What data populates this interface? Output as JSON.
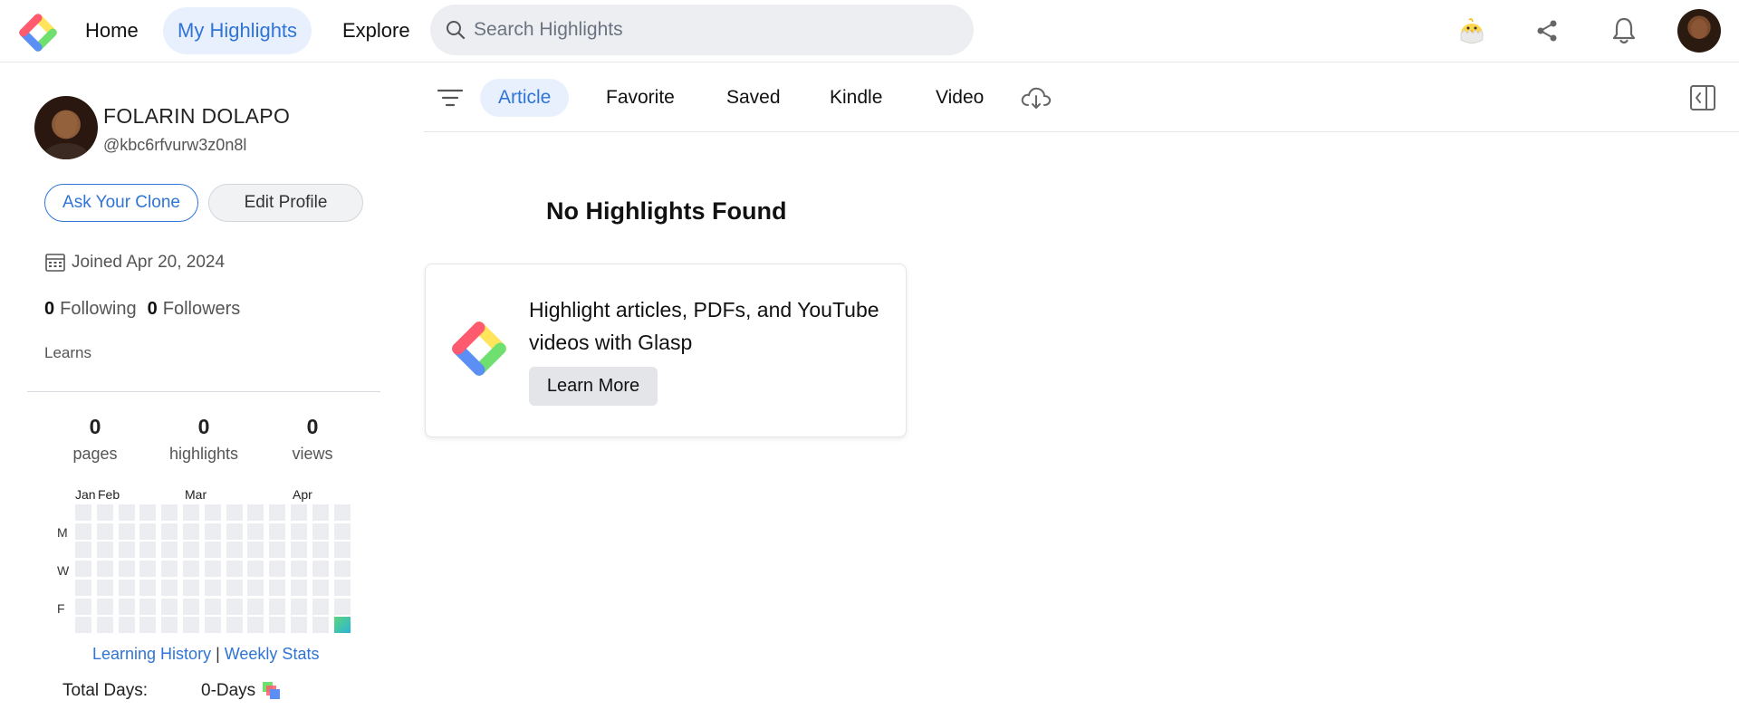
{
  "topbar": {
    "nav": {
      "home": "Home",
      "my_highlights": "My Highlights",
      "explore": "Explore"
    },
    "search": {
      "placeholder": "Search Highlights",
      "value": ""
    },
    "icons": [
      "chick-icon",
      "share-icon",
      "bell-icon",
      "avatar"
    ]
  },
  "profile": {
    "name": "FOLARIN DOLAPO",
    "handle": "@kbc6rfvurw3z0n8l",
    "ask_clone_label": "Ask Your Clone",
    "edit_profile_label": "Edit Profile",
    "joined": "Joined Apr 20, 2024",
    "following_count": "0",
    "following_label": "Following",
    "followers_count": "0",
    "followers_label": "Followers",
    "learns_label": "Learns"
  },
  "stats": {
    "pages": {
      "value": "0",
      "label": "pages"
    },
    "highlights": {
      "value": "0",
      "label": "highlights"
    },
    "views": {
      "value": "0",
      "label": "views"
    }
  },
  "heatmap": {
    "months": [
      "Jan",
      "Feb",
      "Mar",
      "Apr"
    ],
    "days": [
      "M",
      "W",
      "F"
    ],
    "weeks": 13,
    "rows": 7,
    "active_cells": [
      [
        12,
        6
      ]
    ],
    "colors": {
      "empty": "#ebedf0",
      "active_start": "#5bd67a",
      "active_end": "#2bb3d9"
    }
  },
  "history": {
    "learning_history": "Learning History",
    "separator": "|",
    "weekly_stats": "Weekly Stats",
    "total_days_label": "Total Days:",
    "total_days_value": "0-Days"
  },
  "tabs": {
    "article": "Article",
    "favorite": "Favorite",
    "saved": "Saved",
    "kindle": "Kindle",
    "video": "Video",
    "active": "Article"
  },
  "empty_state": {
    "title": "No Highlights Found",
    "promo_text": "Highlight articles, PDFs, and YouTube videos with Glasp",
    "learn_more_label": "Learn More"
  },
  "colors": {
    "accent": "#2f74d6",
    "accent_bg": "#e8f0fe",
    "logo_red": "#ff5a6e",
    "logo_yellow": "#ffe45c",
    "logo_green": "#6fe06f",
    "logo_blue": "#5b8ff5"
  }
}
